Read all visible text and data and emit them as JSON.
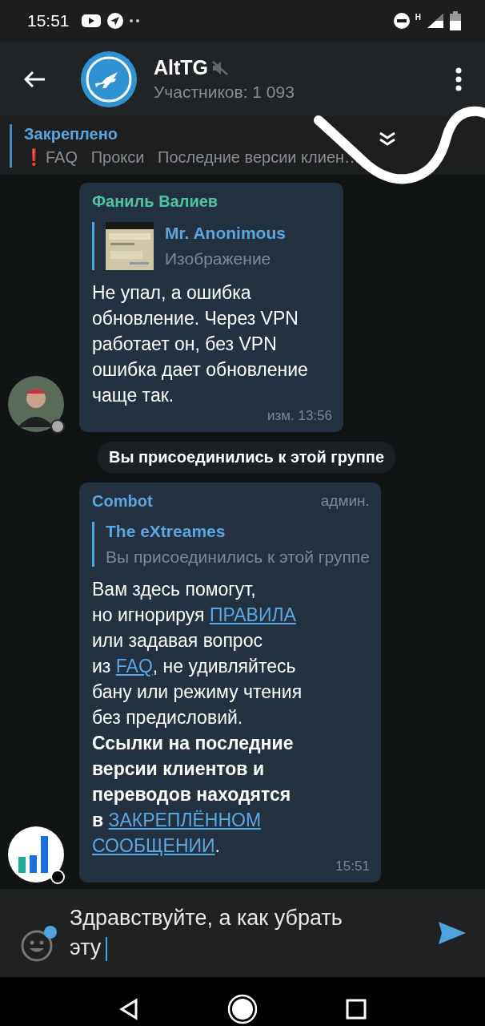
{
  "status_bar": {
    "time": "15:51",
    "network": "H"
  },
  "header": {
    "title": "AltTG",
    "muted": true,
    "subtitle": "Участников: 1 093"
  },
  "pinned": {
    "label": "Закреплено",
    "mark": "❗",
    "text": "FAQ   Прокси   Последние версии клиен…"
  },
  "messages": [
    {
      "kind": "message",
      "sender": "Фаниль Валиев",
      "color": "#4fc3a1",
      "avatar": {
        "kind": "person"
      },
      "online": false,
      "reply": {
        "author": "Mr. Anonimous",
        "text": "Изображение",
        "has_thumbnail": true
      },
      "body": [
        {
          "kind": "text",
          "text": "Не упал, а ошибка\nобновление. Через VPN\nработает он, без VPN\nошибка дает обновление\nчаще так."
        }
      ],
      "time": "изм. 13:56"
    },
    {
      "kind": "service",
      "text": "Вы присоединились к этой группе"
    },
    {
      "kind": "message",
      "sender": "Combot",
      "color": "#5aa7e0",
      "badge": "админ.",
      "avatar": {
        "kind": "bars"
      },
      "online": true,
      "reply": {
        "author": "The eXtreames",
        "text": "Вы присоединились к этой группе",
        "has_thumbnail": false
      },
      "body": [
        {
          "kind": "text",
          "text": "Вам здесь помогут,\nно игнорируя "
        },
        {
          "kind": "link",
          "text": "ПРАВИЛА"
        },
        {
          "kind": "text",
          "text": "\nили задавая вопрос\nиз "
        },
        {
          "kind": "link",
          "text": "FAQ"
        },
        {
          "kind": "text",
          "text": ", не удивляйтесь\nбану или режиму чтения\nбез предисловий.\n"
        },
        {
          "kind": "bold",
          "text": "Ссылки на последние\nверсии клиентов и\nпереводов находятся\nв "
        },
        {
          "kind": "link",
          "text": "ЗАКРЕПЛЁННОМ"
        },
        {
          "kind": "break"
        },
        {
          "kind": "link",
          "text": "СООБЩЕНИИ"
        },
        {
          "kind": "text",
          "text": "."
        }
      ],
      "time": "15:51"
    }
  ],
  "composer": {
    "value": "Здравствуйте, а как убрать эту",
    "emoji_badge": true
  }
}
